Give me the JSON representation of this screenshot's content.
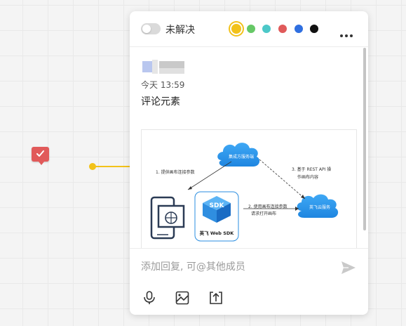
{
  "header": {
    "resolved_toggle": "off",
    "status_label": "未解决",
    "colors": [
      "#f2c21a",
      "#66c866",
      "#4cc8c8",
      "#e05a5a",
      "#2f6fe0",
      "#111111"
    ],
    "selected_color": "#f2c21a",
    "more_icon": "more-horizontal-icon"
  },
  "comment": {
    "time": "今天 13:59",
    "text": "评论元素"
  },
  "attachment": {
    "cloud_top_label": "集成方服务端",
    "cloud_right_label": "英飞云服务",
    "sdk_badge": "SDK",
    "sdk_label": "英飞 Web SDK",
    "step1": "1. 提供画布连接参数",
    "step2_line1": "2. 使用画布连接参数",
    "step2_line2": "请求打开画布",
    "step3_line1": "3. 基于 REST API 操",
    "step3_line2": "作画布内容"
  },
  "reply": {
    "placeholder": "添加回复, 可@其他成员",
    "send_icon": "send-icon",
    "tools": [
      "microphone-icon",
      "image-icon",
      "upload-icon"
    ]
  },
  "marker_icon": "comment-check-icon"
}
